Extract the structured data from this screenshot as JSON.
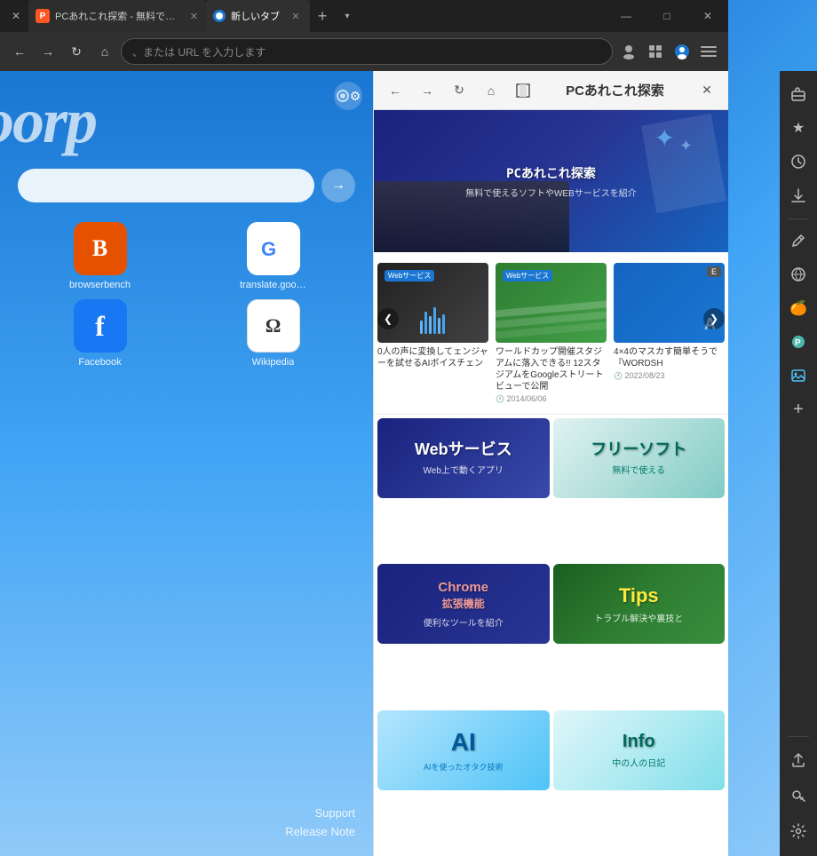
{
  "window": {
    "title": "新しいタブ",
    "tabs": [
      {
        "label": "PCあれこれ探索 - 無料で使えるフリー...",
        "favicon_color": "#ff5722",
        "active": false
      },
      {
        "label": "新しいタブ",
        "favicon_color": "#1976d2",
        "active": true
      }
    ],
    "new_tab_label": "+",
    "minimize": "—",
    "maximize": "□",
    "close": "✕"
  },
  "addressbar": {
    "placeholder": "、または URL を入力します",
    "back": "←",
    "forward": "→",
    "refresh": "↻",
    "home": "⌂"
  },
  "newtab": {
    "brand": "oorp",
    "search_placeholder": "",
    "settings_icon": "⚙",
    "speed_dials": [
      {
        "label": "browserbench",
        "color": "#e65100",
        "icon": "B"
      },
      {
        "label": "translate.google",
        "color": "#ffffff",
        "icon_color": "#4285f4",
        "icon": "G"
      },
      {
        "label": "Facebook",
        "color": "#1877f2",
        "icon": "f"
      },
      {
        "label": "Wikipedia",
        "color": "#ffffff",
        "icon_color": "#333",
        "icon": "W"
      }
    ],
    "bottom_links": {
      "support": "Support",
      "release_note": "Release Note"
    }
  },
  "panel": {
    "title": "PCあれこれ探索",
    "hero": {
      "title": "PCあれこれ探索",
      "subtitle": "無料で使えるソフトやWEBサービスを紹介"
    },
    "carousel": {
      "items": [
        {
          "badge": "Webサービス",
          "caption": "0人の声に変換してェンジャーを試せるAIボイスチェン",
          "date": "",
          "bg": "dark"
        },
        {
          "badge": "Webサービス",
          "caption": "ワールドカップ開催スタジアムに落入できる!! 12スタジアムをGoogleストリートビューで公開",
          "date": "2014/06/06",
          "bg": "green"
        },
        {
          "badge": "E",
          "caption": "4×4のマスカす簡単そうで『WORDSH",
          "date": "2022/08/23",
          "bg": "blue"
        }
      ],
      "prev": "❮",
      "next": "❯"
    },
    "categories": [
      {
        "label": "Webサービス",
        "sub": "Web上で動くアプリ",
        "style": "web"
      },
      {
        "label": "フリーソフト",
        "sub": "無料で使える",
        "style": "free"
      },
      {
        "label": "Chrome\n拡張機能",
        "sub": "便利なツールを紹介",
        "style": "chrome"
      },
      {
        "label": "Tips",
        "sub": "トラブル解決や裏技と",
        "style": "tips"
      },
      {
        "label": "AI",
        "sub": "AIを使ったオタク技術",
        "style": "ai"
      },
      {
        "label": "Info\n中の人の日記",
        "sub": "",
        "style": "info"
      }
    ]
  },
  "right_sidebar": {
    "icons": [
      {
        "name": "briefcase-icon",
        "symbol": "💼",
        "active": false
      },
      {
        "name": "star-icon",
        "symbol": "★",
        "active": false
      },
      {
        "name": "clock-icon",
        "symbol": "🕐",
        "active": false
      },
      {
        "name": "download-icon",
        "symbol": "⬇",
        "active": false
      },
      {
        "name": "pen-icon",
        "symbol": "✏",
        "active": false
      },
      {
        "name": "translate-icon",
        "symbol": "🌐",
        "active": false
      },
      {
        "name": "fruit-icon",
        "symbol": "🍊",
        "active": false
      },
      {
        "name": "circle-f-icon",
        "symbol": "🅕",
        "active": false
      },
      {
        "name": "image-icon",
        "symbol": "🖼",
        "active": true
      },
      {
        "name": "add-icon",
        "symbol": "+",
        "active": false
      }
    ],
    "bottom_icons": [
      {
        "name": "share-icon",
        "symbol": "↑"
      },
      {
        "name": "key-icon",
        "symbol": "🔑"
      },
      {
        "name": "settings-icon",
        "symbol": "⚙"
      }
    ]
  }
}
